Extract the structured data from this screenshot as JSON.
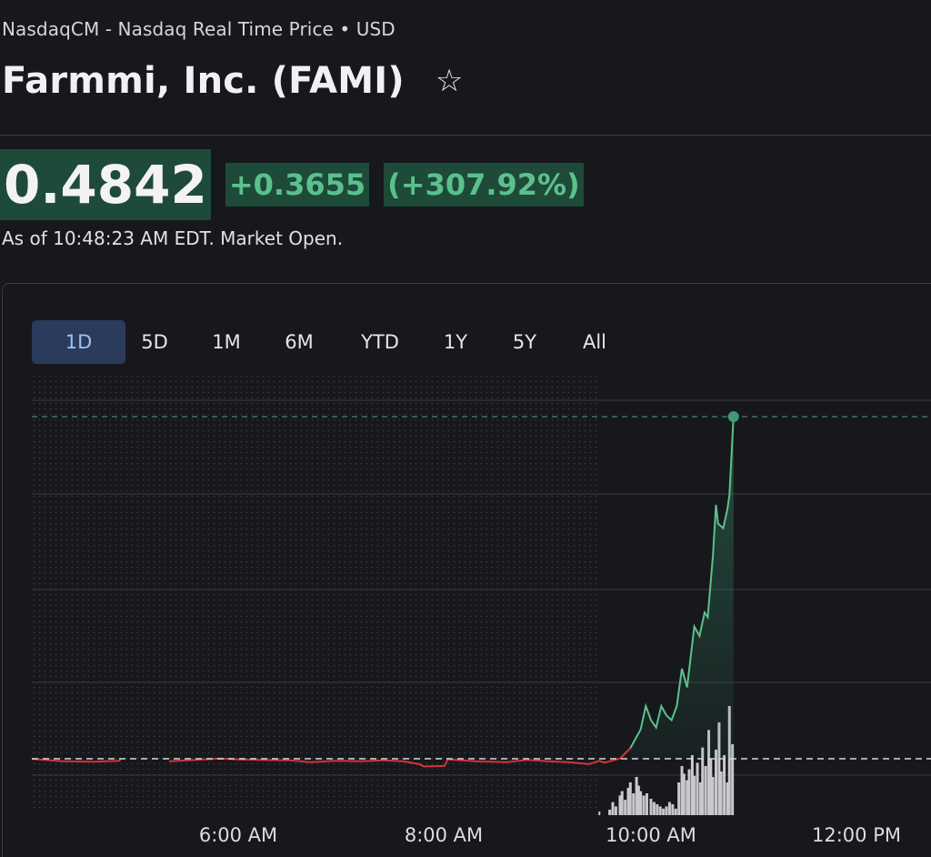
{
  "header": {
    "exchange_line": "NasdaqCM - Nasdaq Real Time Price • USD",
    "title": "Farmmi, Inc. (FAMI)",
    "watchlist_icon": "star-outline-icon"
  },
  "quote": {
    "price": "0.4842",
    "change": "+0.3655",
    "change_percent": "(+307.92%)",
    "as_of": "As of 10:48:23 AM EDT. Market Open."
  },
  "colors": {
    "background": "#17181c",
    "positive": "#5cc08c",
    "positive_bg": "#1e4a3a",
    "negative": "#d6333a",
    "active_tab_bg": "#2a3b5c",
    "active_tab_text": "#9fc3f5"
  },
  "range_tabs": [
    {
      "label": "1D",
      "active": true
    },
    {
      "label": "5D",
      "active": false
    },
    {
      "label": "1M",
      "active": false
    },
    {
      "label": "6M",
      "active": false
    },
    {
      "label": "YTD",
      "active": false
    },
    {
      "label": "1Y",
      "active": false
    },
    {
      "label": "5Y",
      "active": false
    },
    {
      "label": "All",
      "active": false
    }
  ],
  "chart_data": {
    "type": "line",
    "x_ticks": [
      "6:00 AM",
      "8:00 AM",
      "10:00 AM",
      "12:00 PM"
    ],
    "previous_close_line": true,
    "grid": true,
    "premarket_shaded": true,
    "price_series": [
      {
        "t": 4.0,
        "p": 0.1185
      },
      {
        "t": 4.3,
        "p": 0.116
      },
      {
        "t": 4.6,
        "p": 0.1155
      },
      {
        "t": 4.85,
        "p": 0.1165
      },
      {
        "t": 4.86,
        "p": 0.1187
      },
      {
        "t": 5.33,
        "p": 0.116
      },
      {
        "t": 5.6,
        "p": 0.1175
      },
      {
        "t": 5.82,
        "p": 0.119
      },
      {
        "t": 6.0,
        "p": 0.118
      },
      {
        "t": 6.2,
        "p": 0.1175
      },
      {
        "t": 6.5,
        "p": 0.117
      },
      {
        "t": 6.7,
        "p": 0.115
      },
      {
        "t": 6.95,
        "p": 0.1165
      },
      {
        "t": 7.2,
        "p": 0.116
      },
      {
        "t": 7.4,
        "p": 0.117
      },
      {
        "t": 7.6,
        "p": 0.116
      },
      {
        "t": 7.75,
        "p": 0.113
      },
      {
        "t": 7.8,
        "p": 0.1105
      },
      {
        "t": 8.0,
        "p": 0.111
      },
      {
        "t": 8.03,
        "p": 0.118
      },
      {
        "t": 8.3,
        "p": 0.116
      },
      {
        "t": 8.6,
        "p": 0.115
      },
      {
        "t": 8.8,
        "p": 0.1175
      },
      {
        "t": 9.0,
        "p": 0.116
      },
      {
        "t": 9.2,
        "p": 0.115
      },
      {
        "t": 9.4,
        "p": 0.113
      },
      {
        "t": 9.5,
        "p": 0.1165
      },
      {
        "t": 9.55,
        "p": 0.1145
      },
      {
        "t": 9.6,
        "p": 0.116
      },
      {
        "t": 9.7,
        "p": 0.119
      },
      {
        "t": 9.8,
        "p": 0.13
      },
      {
        "t": 9.9,
        "p": 0.15
      },
      {
        "t": 9.95,
        "p": 0.175
      },
      {
        "t": 10.0,
        "p": 0.16
      },
      {
        "t": 10.05,
        "p": 0.152
      },
      {
        "t": 10.1,
        "p": 0.175
      },
      {
        "t": 10.15,
        "p": 0.165
      },
      {
        "t": 10.2,
        "p": 0.16
      },
      {
        "t": 10.25,
        "p": 0.175
      },
      {
        "t": 10.3,
        "p": 0.215
      },
      {
        "t": 10.35,
        "p": 0.195
      },
      {
        "t": 10.42,
        "p": 0.26
      },
      {
        "t": 10.47,
        "p": 0.25
      },
      {
        "t": 10.52,
        "p": 0.275
      },
      {
        "t": 10.55,
        "p": 0.27
      },
      {
        "t": 10.6,
        "p": 0.335
      },
      {
        "t": 10.63,
        "p": 0.39
      },
      {
        "t": 10.65,
        "p": 0.37
      },
      {
        "t": 10.7,
        "p": 0.365
      },
      {
        "t": 10.74,
        "p": 0.385
      },
      {
        "t": 10.76,
        "p": 0.4
      },
      {
        "t": 10.8,
        "p": 0.4842
      }
    ],
    "previous_close": 0.1187,
    "last_price": 0.4842,
    "volume_series": [
      {
        "t": 9.6,
        "v": 0.05
      },
      {
        "t": 9.63,
        "v": 0.12
      },
      {
        "t": 9.66,
        "v": 0.08
      },
      {
        "t": 9.7,
        "v": 0.18
      },
      {
        "t": 9.72,
        "v": 0.22
      },
      {
        "t": 9.75,
        "v": 0.14
      },
      {
        "t": 9.78,
        "v": 0.25
      },
      {
        "t": 9.8,
        "v": 0.3
      },
      {
        "t": 9.83,
        "v": 0.2
      },
      {
        "t": 9.86,
        "v": 0.35
      },
      {
        "t": 9.88,
        "v": 0.27
      },
      {
        "t": 9.9,
        "v": 0.22
      },
      {
        "t": 9.93,
        "v": 0.18
      },
      {
        "t": 9.96,
        "v": 0.2
      },
      {
        "t": 10.0,
        "v": 0.15
      },
      {
        "t": 10.03,
        "v": 0.12
      },
      {
        "t": 10.06,
        "v": 0.1
      },
      {
        "t": 10.09,
        "v": 0.08
      },
      {
        "t": 10.12,
        "v": 0.06
      },
      {
        "t": 10.15,
        "v": 0.08
      },
      {
        "t": 10.18,
        "v": 0.12
      },
      {
        "t": 10.21,
        "v": 0.1
      },
      {
        "t": 10.24,
        "v": 0.06
      },
      {
        "t": 10.27,
        "v": 0.3
      },
      {
        "t": 10.3,
        "v": 0.45
      },
      {
        "t": 10.32,
        "v": 0.38
      },
      {
        "t": 10.35,
        "v": 0.32
      },
      {
        "t": 10.37,
        "v": 0.42
      },
      {
        "t": 10.4,
        "v": 0.55
      },
      {
        "t": 10.42,
        "v": 0.36
      },
      {
        "t": 10.45,
        "v": 0.48
      },
      {
        "t": 10.48,
        "v": 0.3
      },
      {
        "t": 10.5,
        "v": 0.62
      },
      {
        "t": 10.53,
        "v": 0.45
      },
      {
        "t": 10.56,
        "v": 0.78
      },
      {
        "t": 10.58,
        "v": 0.52
      },
      {
        "t": 10.6,
        "v": 0.35
      },
      {
        "t": 10.63,
        "v": 0.6
      },
      {
        "t": 10.66,
        "v": 0.85
      },
      {
        "t": 10.68,
        "v": 0.4
      },
      {
        "t": 10.71,
        "v": 0.55
      },
      {
        "t": 10.74,
        "v": 0.3
      },
      {
        "t": 10.76,
        "v": 1.0
      },
      {
        "t": 10.79,
        "v": 0.65
      }
    ]
  }
}
